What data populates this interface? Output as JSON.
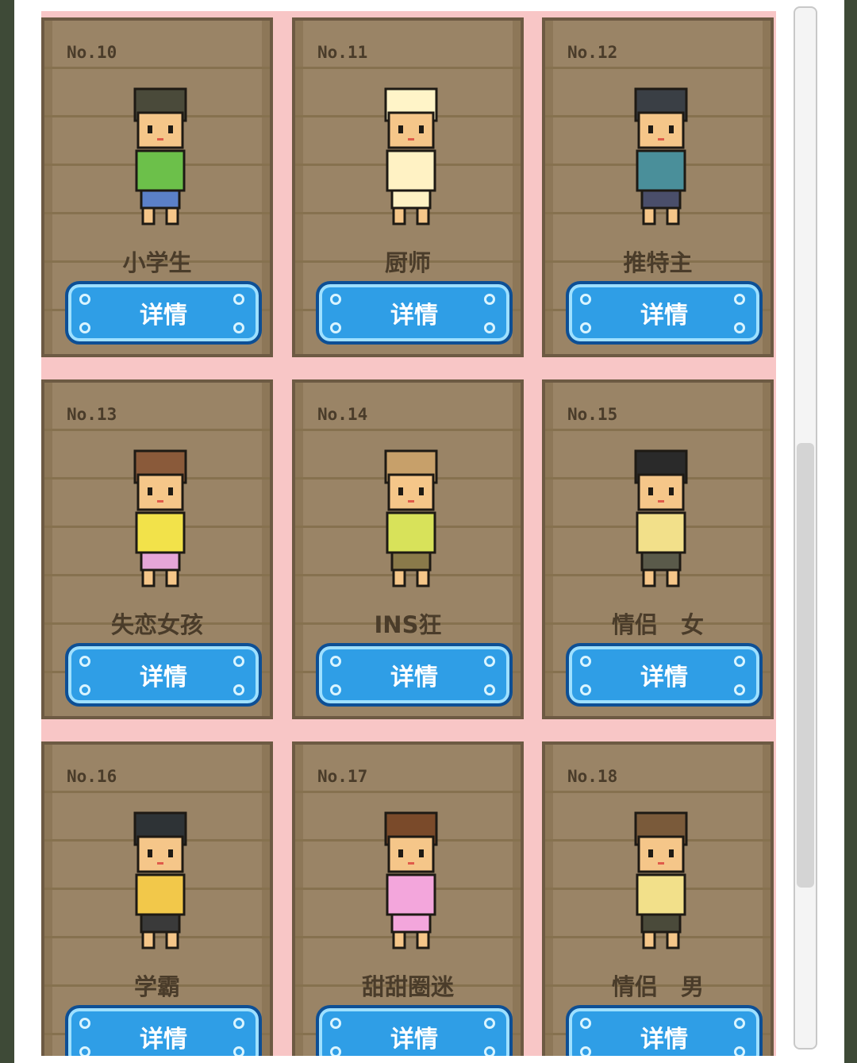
{
  "cards": [
    {
      "no": "No.10",
      "name": "小学生",
      "button": "详情",
      "hair": "#4a4a3a",
      "shirt": "#6cc04a",
      "pants": "#5b80c8",
      "skin": "#f5c689",
      "icon": "student-character-icon"
    },
    {
      "no": "No.11",
      "name": "厨师",
      "button": "详情",
      "hair": "#fff4c8",
      "shirt": "#fff2c4",
      "pants": "#fff2c4",
      "skin": "#f5c689",
      "icon": "chef-character-icon"
    },
    {
      "no": "No.12",
      "name": "推特主",
      "button": "详情",
      "hair": "#3a3f45",
      "shirt": "#4a8f9a",
      "pants": "#4a4e6a",
      "skin": "#f5c689",
      "icon": "twitter-user-character-icon"
    },
    {
      "no": "No.13",
      "name": "失恋女孩",
      "button": "详情",
      "hair": "#8a5a3a",
      "shirt": "#f2e24a",
      "pants": "#e6a6d8",
      "skin": "#f5c689",
      "icon": "heartbroken-girl-character-icon"
    },
    {
      "no": "No.14",
      "name": "INS狂",
      "button": "详情",
      "hair": "#c7a06a",
      "shirt": "#d8e25a",
      "pants": "#8a7a4a",
      "skin": "#f5c689",
      "icon": "ins-fan-character-icon"
    },
    {
      "no": "No.15",
      "name": "情侣　女",
      "button": "详情",
      "hair": "#2a2a2a",
      "shirt": "#f2e08a",
      "pants": "#5a5a4a",
      "skin": "#f5c689",
      "icon": "couple-girl-character-icon"
    },
    {
      "no": "No.16",
      "name": "学霸",
      "button": "详情",
      "hair": "#2e3336",
      "shirt": "#f2c84a",
      "pants": "#3a3a3a",
      "skin": "#f5c689",
      "icon": "top-student-character-icon"
    },
    {
      "no": "No.17",
      "name": "甜甜圈迷",
      "button": "详情",
      "hair": "#7a4a2a",
      "shirt": "#f3a6dc",
      "pants": "#f3a6dc",
      "skin": "#f5c689",
      "icon": "donut-fan-character-icon"
    },
    {
      "no": "No.18",
      "name": "情侣　男",
      "button": "详情",
      "hair": "#7a5a3a",
      "shirt": "#f2e08a",
      "pants": "#4a4a3a",
      "skin": "#f5c689",
      "icon": "couple-boy-character-icon"
    }
  ],
  "colors": {
    "accent": "#2f9ee6",
    "card": "#9a8466",
    "grid_bg": "#f8c6c6"
  }
}
